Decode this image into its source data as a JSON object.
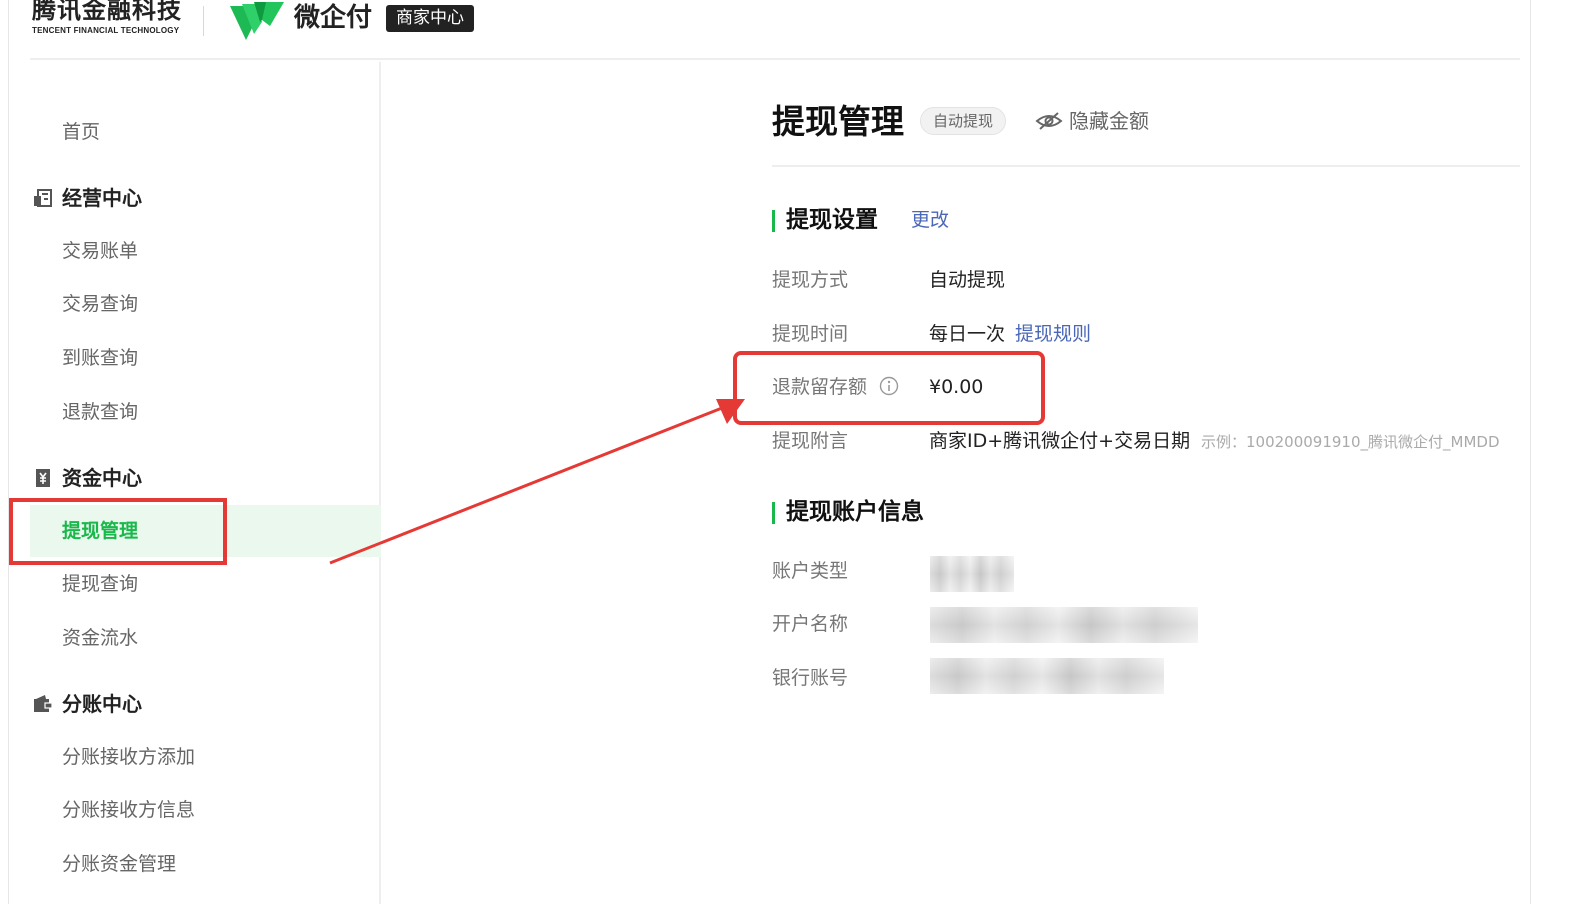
{
  "header": {
    "tencent_fintech_cn": "腾讯金融科技",
    "tencent_fintech_en": "TENCENT FINANCIAL TECHNOLOGY",
    "product_name": "微企付",
    "merchant_center": "商家中心"
  },
  "sidebar": {
    "home": "首页",
    "groups": [
      {
        "title": "经营中心",
        "icon": "ledger-icon",
        "items": [
          "交易账单",
          "交易查询",
          "到账查询",
          "退款查询"
        ]
      },
      {
        "title": "资金中心",
        "icon": "yuan-icon",
        "items": [
          "提现管理",
          "提现查询",
          "资金流水"
        ]
      },
      {
        "title": "分账中心",
        "icon": "wallet-icon",
        "items": [
          "分账接收方添加",
          "分账接收方信息",
          "分账资金管理"
        ]
      }
    ],
    "active_item": "提现管理"
  },
  "main": {
    "title": "提现管理",
    "mode_badge": "自动提现",
    "hide_amount": "隐藏金额",
    "settings": {
      "title": "提现设置",
      "edit_link": "更改",
      "rows": {
        "method": {
          "label": "提现方式",
          "value": "自动提现"
        },
        "time": {
          "label": "提现时间",
          "value": "每日一次",
          "link": "提现规则"
        },
        "reserve": {
          "label": "退款留存额",
          "value": "¥0.00"
        },
        "remark": {
          "label": "提现附言",
          "value": "商家ID+腾讯微企付+交易日期",
          "example": "示例：100200091910_腾讯微企付_MMDD"
        }
      }
    },
    "account": {
      "title": "提现账户信息",
      "rows": {
        "type": {
          "label": "账户类型"
        },
        "name": {
          "label": "开户名称"
        },
        "number": {
          "label": "银行账号"
        }
      }
    }
  },
  "colors": {
    "brand_green": "#18b84a",
    "link_blue": "#4a67b8",
    "annotation_red": "#e53935",
    "active_bg": "#ebf8ee"
  }
}
